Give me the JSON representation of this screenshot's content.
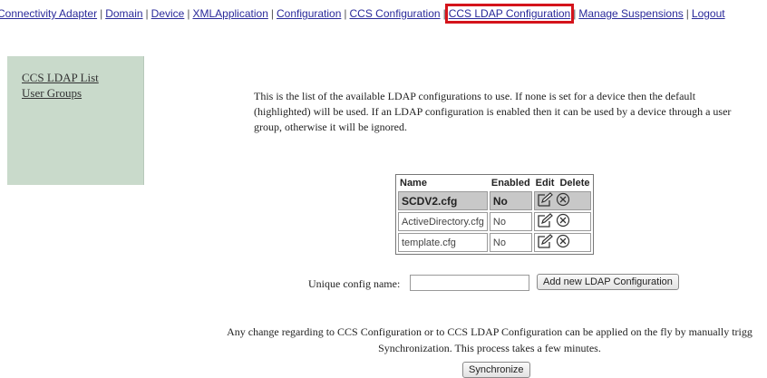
{
  "nav": {
    "items": [
      {
        "label": "Connectivity Adapter",
        "active": false
      },
      {
        "label": "Domain",
        "active": false
      },
      {
        "label": "Device",
        "active": false
      },
      {
        "label": "XMLApplication",
        "active": false
      },
      {
        "label": "Configuration",
        "active": false
      },
      {
        "label": "CCS Configuration",
        "active": false
      },
      {
        "label": "CCS LDAP Configuration",
        "active": true
      },
      {
        "label": "Manage Suspensions",
        "active": false
      },
      {
        "label": "Logout",
        "active": false
      }
    ],
    "separator": "|"
  },
  "sidebar": {
    "links": [
      {
        "label": "CCS LDAP List"
      },
      {
        "label": "User Groups"
      }
    ]
  },
  "intro_text": "This is the list of the available LDAP configurations to use. If none is set for a device then the default (highlighted) will be used. If an LDAP configuration is enabled then it can be used by a device through a user group, otherwise it will be ignored.",
  "table": {
    "headers": [
      "Name",
      "Enabled",
      "Edit",
      "Delete"
    ],
    "rows": [
      {
        "name": "SCDV2.cfg",
        "enabled": "No",
        "default": true
      },
      {
        "name": "ActiveDirectory.cfg",
        "enabled": "No",
        "default": false
      },
      {
        "name": "template.cfg",
        "enabled": "No",
        "default": false
      }
    ]
  },
  "form": {
    "label": "Unique config name:",
    "input_value": "",
    "add_button": "Add new LDAP Configuration"
  },
  "note": {
    "line1": "Any change regarding to CCS Configuration or to CCS LDAP Configuration can be applied on the fly by manually trigg",
    "line2": "Synchronization. This process takes a few minutes.",
    "sync_button": "Synchronize"
  },
  "colors": {
    "highlight_border": "#d4141b",
    "sidebar_bg": "#c9dacb",
    "default_row_bg": "#c8c8c8",
    "link": "#2a2a9a"
  }
}
